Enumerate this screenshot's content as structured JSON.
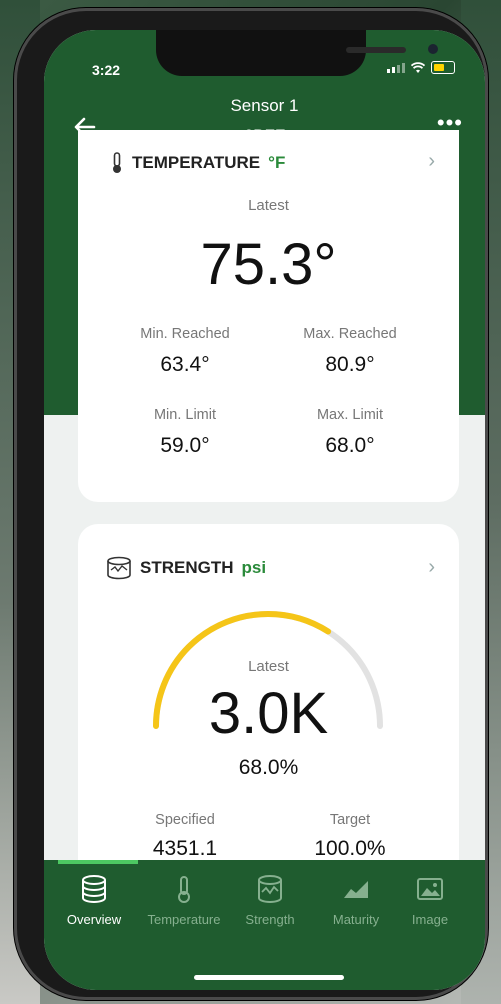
{
  "status_bar": {
    "time": "3:22"
  },
  "header": {
    "title": "Sensor 1",
    "subtitle": "6BFF",
    "more": "•••"
  },
  "temperature_card": {
    "title": "TEMPERATURE",
    "unit": "°F",
    "latest_label": "Latest",
    "latest_value": "75.3°",
    "min_reached_label": "Min. Reached",
    "min_reached_value": "63.4°",
    "max_reached_label": "Max. Reached",
    "max_reached_value": "80.9°",
    "min_limit_label": "Min. Limit",
    "min_limit_value": "59.0°",
    "max_limit_label": "Max. Limit",
    "max_limit_value": "68.0°"
  },
  "strength_card": {
    "title": "STRENGTH",
    "unit": "psi",
    "latest_label": "Latest",
    "latest_value": "3.0K",
    "percent": "68.0%",
    "gauge_fraction": 0.68,
    "specified_label": "Specified",
    "specified_value": "4351.1",
    "target_label": "Target",
    "target_value": "100.0%"
  },
  "tabs": [
    {
      "label": "Overview",
      "icon": "database-icon",
      "active": true
    },
    {
      "label": "Temperature",
      "icon": "thermometer-icon",
      "active": false
    },
    {
      "label": "Strength",
      "icon": "strength-cylinder-icon",
      "active": false
    },
    {
      "label": "Maturity",
      "icon": "area-chart-icon",
      "active": false
    },
    {
      "label": "Image",
      "icon": "image-icon",
      "active": false
    }
  ],
  "colors": {
    "brand_green": "#1f5c2f",
    "accent_green": "#2a8a3a",
    "gauge_yellow": "#f5c518"
  }
}
